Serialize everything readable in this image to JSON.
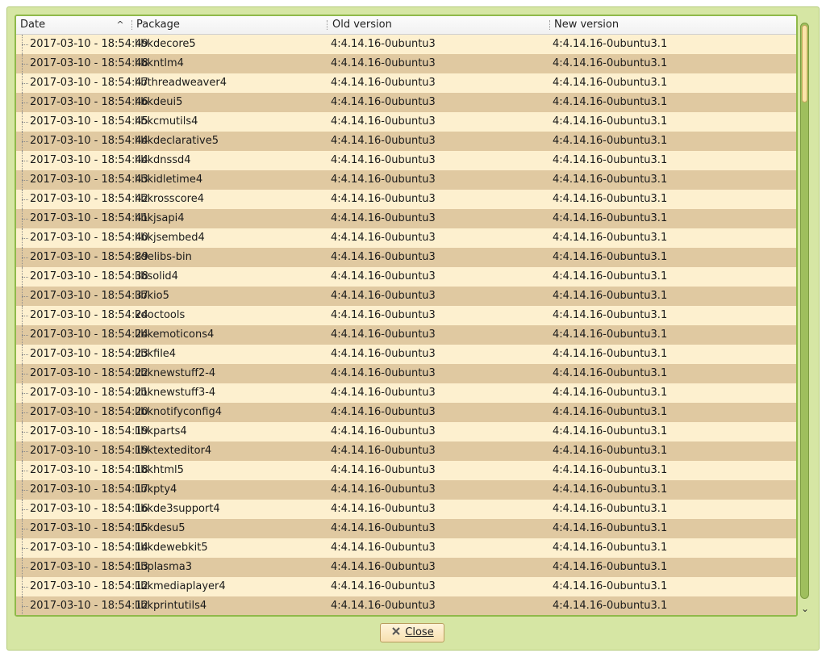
{
  "table": {
    "headers": {
      "date": "Date",
      "package": "Package",
      "old": "Old version",
      "new": "New version"
    },
    "sort_indicator": "^",
    "rows": [
      {
        "date": "2017-03-10 - 18:54:49",
        "package": "libkdecore5",
        "old": "4:4.14.16-0ubuntu3",
        "new": "4:4.14.16-0ubuntu3.1"
      },
      {
        "date": "2017-03-10 - 18:54:48",
        "package": "libkntlm4",
        "old": "4:4.14.16-0ubuntu3",
        "new": "4:4.14.16-0ubuntu3.1"
      },
      {
        "date": "2017-03-10 - 18:54:47",
        "package": "libthreadweaver4",
        "old": "4:4.14.16-0ubuntu3",
        "new": "4:4.14.16-0ubuntu3.1"
      },
      {
        "date": "2017-03-10 - 18:54:46",
        "package": "libkdeui5",
        "old": "4:4.14.16-0ubuntu3",
        "new": "4:4.14.16-0ubuntu3.1"
      },
      {
        "date": "2017-03-10 - 18:54:45",
        "package": "libkcmutils4",
        "old": "4:4.14.16-0ubuntu3",
        "new": "4:4.14.16-0ubuntu3.1"
      },
      {
        "date": "2017-03-10 - 18:54:44",
        "package": "libkdeclarative5",
        "old": "4:4.14.16-0ubuntu3",
        "new": "4:4.14.16-0ubuntu3.1"
      },
      {
        "date": "2017-03-10 - 18:54:44",
        "package": "libkdnssd4",
        "old": "4:4.14.16-0ubuntu3",
        "new": "4:4.14.16-0ubuntu3.1"
      },
      {
        "date": "2017-03-10 - 18:54:43",
        "package": "libkidletime4",
        "old": "4:4.14.16-0ubuntu3",
        "new": "4:4.14.16-0ubuntu3.1"
      },
      {
        "date": "2017-03-10 - 18:54:42",
        "package": "libkrosscore4",
        "old": "4:4.14.16-0ubuntu3",
        "new": "4:4.14.16-0ubuntu3.1"
      },
      {
        "date": "2017-03-10 - 18:54:41",
        "package": "libkjsapi4",
        "old": "4:4.14.16-0ubuntu3",
        "new": "4:4.14.16-0ubuntu3.1"
      },
      {
        "date": "2017-03-10 - 18:54:40",
        "package": "libkjsembed4",
        "old": "4:4.14.16-0ubuntu3",
        "new": "4:4.14.16-0ubuntu3.1"
      },
      {
        "date": "2017-03-10 - 18:54:39",
        "package": "kdelibs-bin",
        "old": "4:4.14.16-0ubuntu3",
        "new": "4:4.14.16-0ubuntu3.1"
      },
      {
        "date": "2017-03-10 - 18:54:38",
        "package": "libsolid4",
        "old": "4:4.14.16-0ubuntu3",
        "new": "4:4.14.16-0ubuntu3.1"
      },
      {
        "date": "2017-03-10 - 18:54:37",
        "package": "libkio5",
        "old": "4:4.14.16-0ubuntu3",
        "new": "4:4.14.16-0ubuntu3.1"
      },
      {
        "date": "2017-03-10 - 18:54:24",
        "package": "kdoctools",
        "old": "4:4.14.16-0ubuntu3",
        "new": "4:4.14.16-0ubuntu3.1"
      },
      {
        "date": "2017-03-10 - 18:54:24",
        "package": "libkemoticons4",
        "old": "4:4.14.16-0ubuntu3",
        "new": "4:4.14.16-0ubuntu3.1"
      },
      {
        "date": "2017-03-10 - 18:54:23",
        "package": "libkfile4",
        "old": "4:4.14.16-0ubuntu3",
        "new": "4:4.14.16-0ubuntu3.1"
      },
      {
        "date": "2017-03-10 - 18:54:22",
        "package": "libknewstuff2-4",
        "old": "4:4.14.16-0ubuntu3",
        "new": "4:4.14.16-0ubuntu3.1"
      },
      {
        "date": "2017-03-10 - 18:54:21",
        "package": "libknewstuff3-4",
        "old": "4:4.14.16-0ubuntu3",
        "new": "4:4.14.16-0ubuntu3.1"
      },
      {
        "date": "2017-03-10 - 18:54:20",
        "package": "libknotifyconfig4",
        "old": "4:4.14.16-0ubuntu3",
        "new": "4:4.14.16-0ubuntu3.1"
      },
      {
        "date": "2017-03-10 - 18:54:19",
        "package": "libkparts4",
        "old": "4:4.14.16-0ubuntu3",
        "new": "4:4.14.16-0ubuntu3.1"
      },
      {
        "date": "2017-03-10 - 18:54:19",
        "package": "libktexteditor4",
        "old": "4:4.14.16-0ubuntu3",
        "new": "4:4.14.16-0ubuntu3.1"
      },
      {
        "date": "2017-03-10 - 18:54:18",
        "package": "libkhtml5",
        "old": "4:4.14.16-0ubuntu3",
        "new": "4:4.14.16-0ubuntu3.1"
      },
      {
        "date": "2017-03-10 - 18:54:17",
        "package": "libkpty4",
        "old": "4:4.14.16-0ubuntu3",
        "new": "4:4.14.16-0ubuntu3.1"
      },
      {
        "date": "2017-03-10 - 18:54:16",
        "package": "libkde3support4",
        "old": "4:4.14.16-0ubuntu3",
        "new": "4:4.14.16-0ubuntu3.1"
      },
      {
        "date": "2017-03-10 - 18:54:15",
        "package": "libkdesu5",
        "old": "4:4.14.16-0ubuntu3",
        "new": "4:4.14.16-0ubuntu3.1"
      },
      {
        "date": "2017-03-10 - 18:54:14",
        "package": "libkdewebkit5",
        "old": "4:4.14.16-0ubuntu3",
        "new": "4:4.14.16-0ubuntu3.1"
      },
      {
        "date": "2017-03-10 - 18:54:13",
        "package": "libplasma3",
        "old": "4:4.14.16-0ubuntu3",
        "new": "4:4.14.16-0ubuntu3.1"
      },
      {
        "date": "2017-03-10 - 18:54:12",
        "package": "libkmediaplayer4",
        "old": "4:4.14.16-0ubuntu3",
        "new": "4:4.14.16-0ubuntu3.1"
      },
      {
        "date": "2017-03-10 - 18:54:12",
        "package": "libkprintutils4",
        "old": "4:4.14.16-0ubuntu3",
        "new": "4:4.14.16-0ubuntu3.1"
      }
    ]
  },
  "buttons": {
    "close_label": "Close",
    "close_icon": "close-x-icon"
  },
  "scrollbar": {
    "position_fraction": 0.0
  },
  "colors": {
    "window_bg": "#d6e6a4",
    "row_odd": "#fdf0cf",
    "row_even": "#e0c9a1",
    "frame": "#8fb94a"
  }
}
